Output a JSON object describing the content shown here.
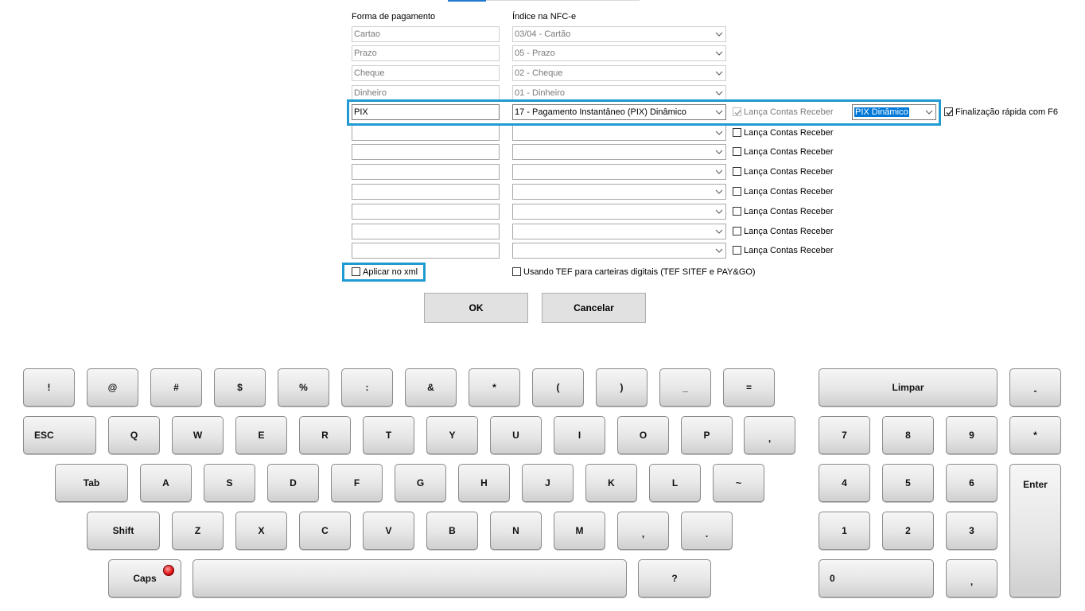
{
  "form": {
    "headers": {
      "forma": "Forma de pagamento",
      "indice": "Índice na NFC-e"
    },
    "rows": [
      {
        "forma": "Cartao",
        "indice": "03/04 - Cartão"
      },
      {
        "forma": "Prazo",
        "indice": "05 - Prazo"
      },
      {
        "forma": "Cheque",
        "indice": "02 - Cheque"
      },
      {
        "forma": "Dinheiro",
        "indice": "01 - Dinheiro"
      },
      {
        "forma": "PIX",
        "indice": "17 - Pagamento Instantâneo (PIX) Dinâmico",
        "lanca_label": "Lança Contas Receber",
        "lanca_checked": true,
        "tipo": "PIX Dinâmico",
        "finalizacao_label": "Finalização rápida com F6",
        "finalizacao_checked": true
      },
      {
        "forma": "",
        "indice": "",
        "lanca_label": "Lança Contas Receber"
      },
      {
        "forma": "",
        "indice": "",
        "lanca_label": "Lança Contas Receber"
      },
      {
        "forma": "",
        "indice": "",
        "lanca_label": "Lança Contas Receber"
      },
      {
        "forma": "",
        "indice": "",
        "lanca_label": "Lança Contas Receber"
      },
      {
        "forma": "",
        "indice": "",
        "lanca_label": "Lança Contas Receber"
      },
      {
        "forma": "",
        "indice": "",
        "lanca_label": "Lança Contas Receber"
      },
      {
        "forma": "",
        "indice": "",
        "lanca_label": "Lança Contas Receber"
      }
    ],
    "aplicar_xml": "Aplicar no xml",
    "usando_tef": "Usando TEF para carteiras digitais (TEF  SITEF e PAY&GO)",
    "ok": "OK",
    "cancelar": "Cancelar"
  },
  "colors": {
    "highlight": "#1f9bd1",
    "selection": "#0078d7"
  },
  "keyboard": {
    "row1": [
      "!",
      "@",
      "#",
      "$",
      "%",
      ":",
      "&",
      "*",
      "(",
      ")",
      "_",
      "="
    ],
    "row2": [
      "ESC",
      "Q",
      "W",
      "E",
      "R",
      "T",
      "Y",
      "U",
      "I",
      "O",
      "P",
      ","
    ],
    "row3": [
      "Tab",
      "A",
      "S",
      "D",
      "F",
      "G",
      "H",
      "J",
      "K",
      "L",
      "~"
    ],
    "row4": [
      "Shift",
      "Z",
      "X",
      "C",
      "V",
      "B",
      "N",
      "M",
      ",",
      "."
    ],
    "row5": [
      "Caps",
      "",
      "?"
    ],
    "numpad": {
      "limpar": "Limpar",
      "minus": "-",
      "star": "*",
      "enter": "Enter",
      "digits": [
        "7",
        "8",
        "9",
        "4",
        "5",
        "6",
        "1",
        "2",
        "3",
        "0",
        ","
      ]
    }
  }
}
